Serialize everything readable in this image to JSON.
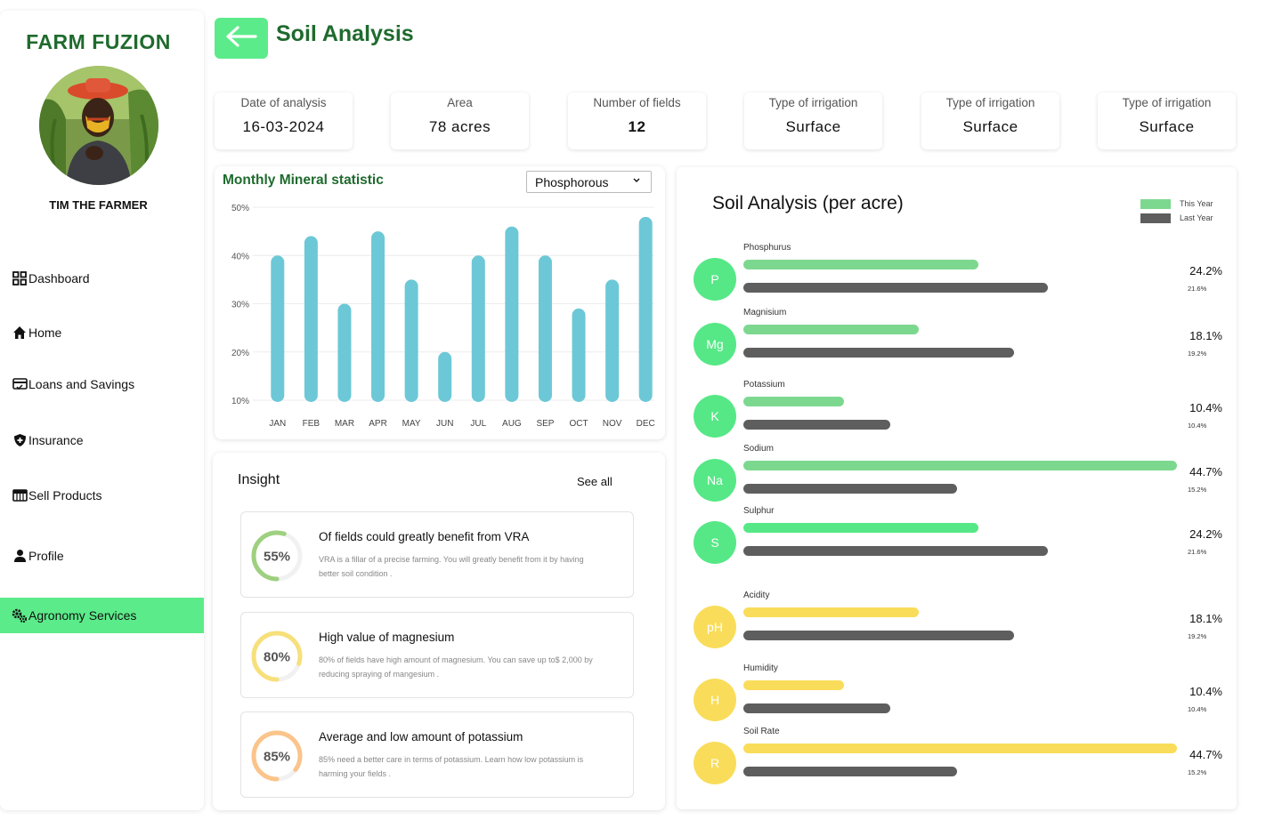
{
  "brand": "FARM FUZION",
  "user": {
    "name": "TIM THE FARMER"
  },
  "nav": [
    {
      "label": "Dashboard",
      "icon": "grid-icon"
    },
    {
      "label": "Home",
      "icon": "home-icon"
    },
    {
      "label": "Loans and Savings",
      "icon": "card-icon"
    },
    {
      "label": "Insurance",
      "icon": "shield-icon"
    },
    {
      "label": "Sell Products",
      "icon": "store-icon"
    },
    {
      "label": "Profile",
      "icon": "user-icon"
    },
    {
      "label": "Agronomy Services",
      "icon": "gears-icon",
      "active": true
    }
  ],
  "header": {
    "title": "Soil Analysis",
    "back_icon": "arrow-left-icon"
  },
  "stats": [
    {
      "label": "Date of analysis",
      "value": "16-03-2024"
    },
    {
      "label": "Area",
      "value": "78 acres"
    },
    {
      "label": "Number of fields",
      "value": "12"
    },
    {
      "label": "Type of irrigation",
      "value": "Surface"
    },
    {
      "label": "Type of irrigation",
      "value": "Surface"
    },
    {
      "label": "Type of irrigation",
      "value": "Surface"
    }
  ],
  "monthly": {
    "title": "Monthly Mineral statistic",
    "select_value": "Phosphorous",
    "bar_color": "#6cc8d6"
  },
  "chart_data": {
    "type": "bar",
    "categories": [
      "JAN",
      "FEB",
      "MAR",
      "APR",
      "MAY",
      "JUN",
      "JUL",
      "AUG",
      "SEP",
      "OCT",
      "NOV",
      "DEC"
    ],
    "values": [
      40,
      44,
      30,
      45,
      35,
      20,
      40,
      46,
      40,
      29,
      35,
      48
    ],
    "yticks": [
      "10%",
      "20%",
      "30%",
      "40%",
      "50%"
    ],
    "ylim": [
      10,
      50
    ],
    "unit": "%",
    "grid": true
  },
  "insight": {
    "title": "Insight",
    "see_all": "See all",
    "items": [
      {
        "pct": "55%",
        "value": 55,
        "color": "#9ed07f",
        "title": "Of fields could greatly benefit from VRA",
        "desc": "VRA is a fillar of a precise farming. You will greatly benefit from it by having better soil condition ."
      },
      {
        "pct": "80%",
        "value": 80,
        "color": "#f7e07a",
        "title": "High value of magnesium",
        "desc": "80% of fields have high amount of magnesium. You can save up to$ 2,000 by reducing spraying of mangesium ."
      },
      {
        "pct": "85%",
        "value": 85,
        "color": "#fbc48a",
        "title": "Average and low amount of potassium",
        "desc": "85% need a better care in terms of potassium. Learn how low potassium is harming your fields ."
      }
    ]
  },
  "soil": {
    "title": "Soil Analysis (per acre)",
    "legend": [
      {
        "label": "This Year",
        "color": "#7dd88f"
      },
      {
        "label": "Last Year",
        "color": "#5e5e5e"
      }
    ],
    "minerals": [
      {
        "symbol": "P",
        "name": "Phosphurus",
        "this_year": "24.2%",
        "last_year": "21.6%",
        "this_val": 24.2,
        "last_val": 21.6,
        "circle": "#56e886",
        "bar": "#7dd88f"
      },
      {
        "symbol": "Mg",
        "name": "Magnisium",
        "this_year": "18.1%",
        "last_year": "19.2%",
        "this_val": 18.1,
        "last_val": 19.2,
        "circle": "#56e886",
        "bar": "#7dd88f"
      },
      {
        "symbol": "K",
        "name": "Potassium",
        "this_year": "10.4%",
        "last_year": "10.4%",
        "this_val": 10.4,
        "last_val": 10.4,
        "circle": "#56e886",
        "bar": "#7dd88f"
      },
      {
        "symbol": "Na",
        "name": "Sodium",
        "this_year": "44.7%",
        "last_year": "15.2%",
        "this_val": 44.7,
        "last_val": 15.2,
        "circle": "#56e886",
        "bar": "#7dd88f"
      },
      {
        "symbol": "S",
        "name": "Sulphur",
        "this_year": "24.2%",
        "last_year": "21.6%",
        "this_val": 24.2,
        "last_val": 21.6,
        "circle": "#56e886",
        "bar": "#56e886"
      },
      {
        "symbol": "pH",
        "name": "Acidity",
        "this_year": "18.1%",
        "last_year": "19.2%",
        "this_val": 18.1,
        "last_val": 19.2,
        "circle": "#f9dd5a",
        "bar": "#f9dd5a"
      },
      {
        "symbol": "H",
        "name": "Humidity",
        "this_year": "10.4%",
        "last_year": "10.4%",
        "this_val": 10.4,
        "last_val": 10.4,
        "circle": "#f9dd5a",
        "bar": "#f9dd5a"
      },
      {
        "symbol": "R",
        "name": "Soil Rate",
        "this_year": "44.7%",
        "last_year": "15.2%",
        "this_val": 44.7,
        "last_val": 15.2,
        "circle": "#f9dd5a",
        "bar": "#f9dd5a"
      }
    ]
  }
}
